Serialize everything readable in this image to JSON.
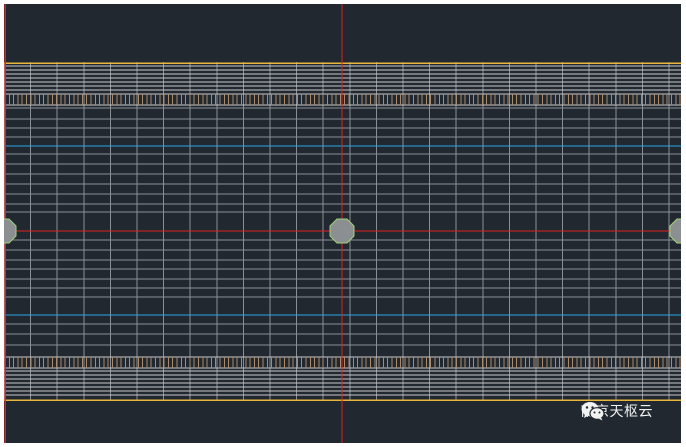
{
  "canvas": {
    "background": "#212830",
    "colors": {
      "outline": "#e8b63c",
      "grid": "#8a8f96",
      "reinforcement": "#c9c9c9",
      "hatch": "#a88a6c",
      "center_axis": "#e02020",
      "blue_lines": "#2aa8e8",
      "bolt_fill": "#8c8f92",
      "bolt_outline": "#9ed07a"
    },
    "icons": [
      "wechat-icon"
    ]
  },
  "watermark": {
    "text": "南京天枢云"
  }
}
